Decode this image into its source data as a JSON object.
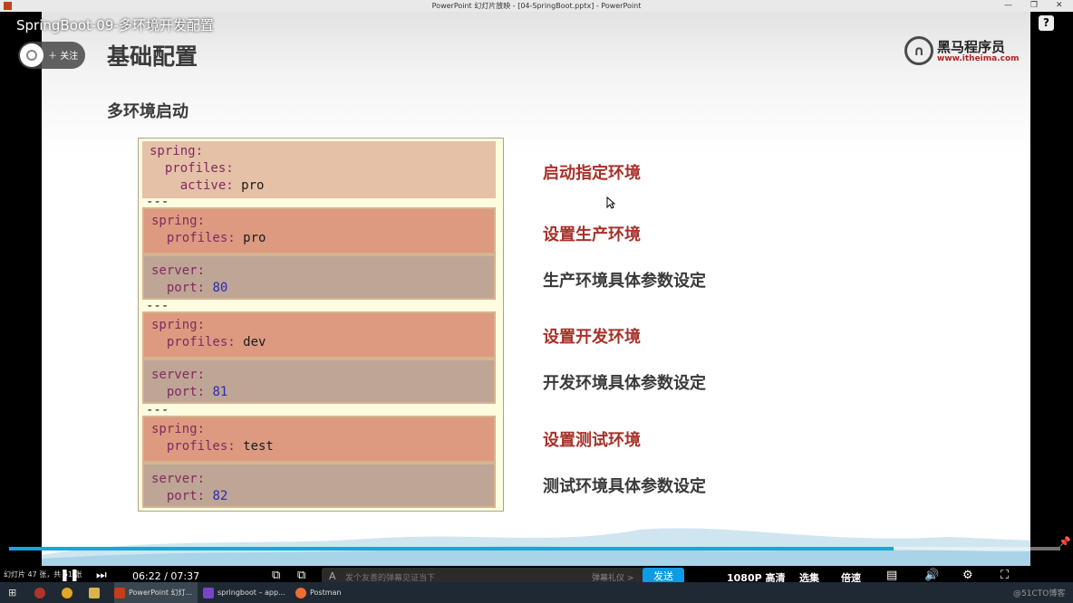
{
  "window": {
    "title": "PowerPoint 幻灯片放映 - [04-SpringBoot.pptx] - PowerPoint"
  },
  "video": {
    "title": "SpringBoot-09-多环境开发配置",
    "follow_label": "关注",
    "help_label": "?"
  },
  "slide": {
    "title": "基础配置",
    "subtitle": "多环境启动",
    "logo_name": "黑马程序员",
    "logo_url": "www.itheima.com"
  },
  "code": {
    "block1": [
      "spring:",
      "  profiles:",
      "    active: pro"
    ],
    "separator": "---",
    "pro_spring": [
      "spring:",
      "  profiles: pro"
    ],
    "pro_server": [
      "server:",
      "  port: 80"
    ],
    "dev_spring": [
      "spring:",
      "  profiles: dev"
    ],
    "dev_server": [
      "server:",
      "  port: 81"
    ],
    "test_spring": [
      "spring:",
      "  profiles: test"
    ],
    "test_server": [
      "server:",
      "  port: 82"
    ]
  },
  "annotations": [
    "启动指定环境",
    "设置生产环境",
    "生产环境具体参数设定",
    "设置开发环境",
    "开发环境具体参数设定",
    "设置测试环境",
    "测试环境具体参数设定"
  ],
  "player": {
    "slide_info": "幻灯片 47 张，共 61 张",
    "time": "06:22 / 07:37",
    "progress": 0.841,
    "danmaku_placeholder": "发个友善的弹幕见证当下",
    "danmaku_etiquette": "弹幕礼仪 >",
    "send_label": "发送",
    "quality": "1080P 高清",
    "episodes": "选集",
    "speed": "倍速"
  },
  "taskbar": {
    "items": [
      "PowerPoint 幻灯...",
      "springboot – app...",
      "Postman"
    ],
    "watermark": "@51CTO博客"
  },
  "colors": {
    "accent_red": "#a8312a",
    "progress_blue": "#16a6e0",
    "send_blue": "#0d9be3"
  }
}
